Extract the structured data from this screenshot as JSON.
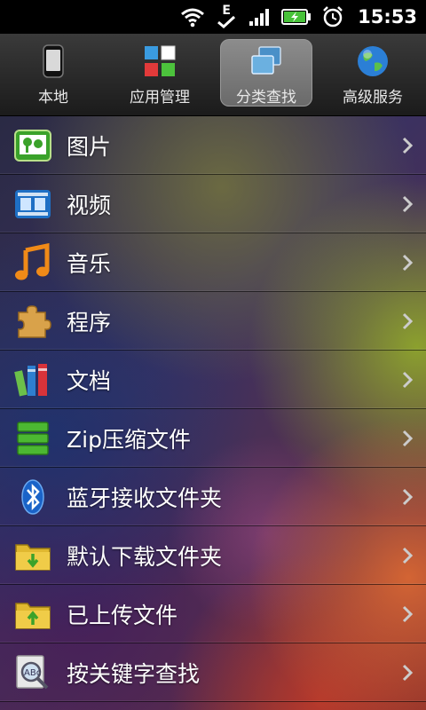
{
  "status_bar": {
    "time": "15:53",
    "network_label": "E"
  },
  "tabs": [
    {
      "label": "本地",
      "icon": "phone-icon",
      "active": false
    },
    {
      "label": "应用管理",
      "icon": "apps-grid-icon",
      "active": false
    },
    {
      "label": "分类查找",
      "icon": "category-windows-icon",
      "active": true
    },
    {
      "label": "高级服务",
      "icon": "globe-icon",
      "active": false
    }
  ],
  "list_items": [
    {
      "label": "图片",
      "icon": "picture-icon"
    },
    {
      "label": "视频",
      "icon": "video-film-icon"
    },
    {
      "label": "音乐",
      "icon": "music-note-icon"
    },
    {
      "label": "程序",
      "icon": "puzzle-piece-icon"
    },
    {
      "label": "文档",
      "icon": "books-icon"
    },
    {
      "label": "Zip压缩文件",
      "icon": "zip-archive-icon"
    },
    {
      "label": "蓝牙接收文件夹",
      "icon": "bluetooth-icon"
    },
    {
      "label": "默认下载文件夹",
      "icon": "download-folder-icon"
    },
    {
      "label": "已上传文件",
      "icon": "upload-folder-icon"
    },
    {
      "label": "按关键字查找",
      "icon": "keyword-search-icon"
    }
  ]
}
